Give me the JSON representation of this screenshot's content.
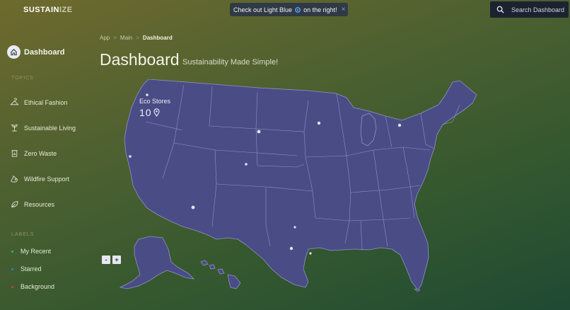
{
  "brand": {
    "part1": "SUSTAIN",
    "part2": "IZE"
  },
  "notice": {
    "text_before": "Check out Light Blue",
    "text_after": "on the right!",
    "close": "×"
  },
  "search": {
    "placeholder": "Search Dashboard"
  },
  "sidebar": {
    "dashboard_label": "Dashboard",
    "topics_heading": "TOPICS",
    "topics": [
      {
        "label": "Ethical Fashion",
        "icon": "hanger-icon"
      },
      {
        "label": "Sustainable Living",
        "icon": "plant-icon"
      },
      {
        "label": "Zero Waste",
        "icon": "recycle-bin-icon"
      },
      {
        "label": "Wildfire Support",
        "icon": "fire-icon"
      },
      {
        "label": "Resources",
        "icon": "leaf-icon"
      }
    ],
    "labels_heading": "LABELS",
    "labels": [
      {
        "label": "My Recent",
        "color": "#3cb043"
      },
      {
        "label": "Starred",
        "color": "#2f7fe0"
      },
      {
        "label": "Background",
        "color": "#e03c3c"
      }
    ]
  },
  "breadcrumb": {
    "items": [
      "App",
      "Main"
    ],
    "current": "Dashboard",
    "separator": ">"
  },
  "header": {
    "title": "Dashboard",
    "subtitle": "Sustainability Made Simple!"
  },
  "map_widget": {
    "stat_label": "Eco Stores",
    "stat_value": "10",
    "zoom_out": "-",
    "zoom_in": "+"
  },
  "colors": {
    "map_fill": "#4a4c86",
    "map_stroke": "#8f93c8",
    "marker": "#dfe3f5"
  }
}
